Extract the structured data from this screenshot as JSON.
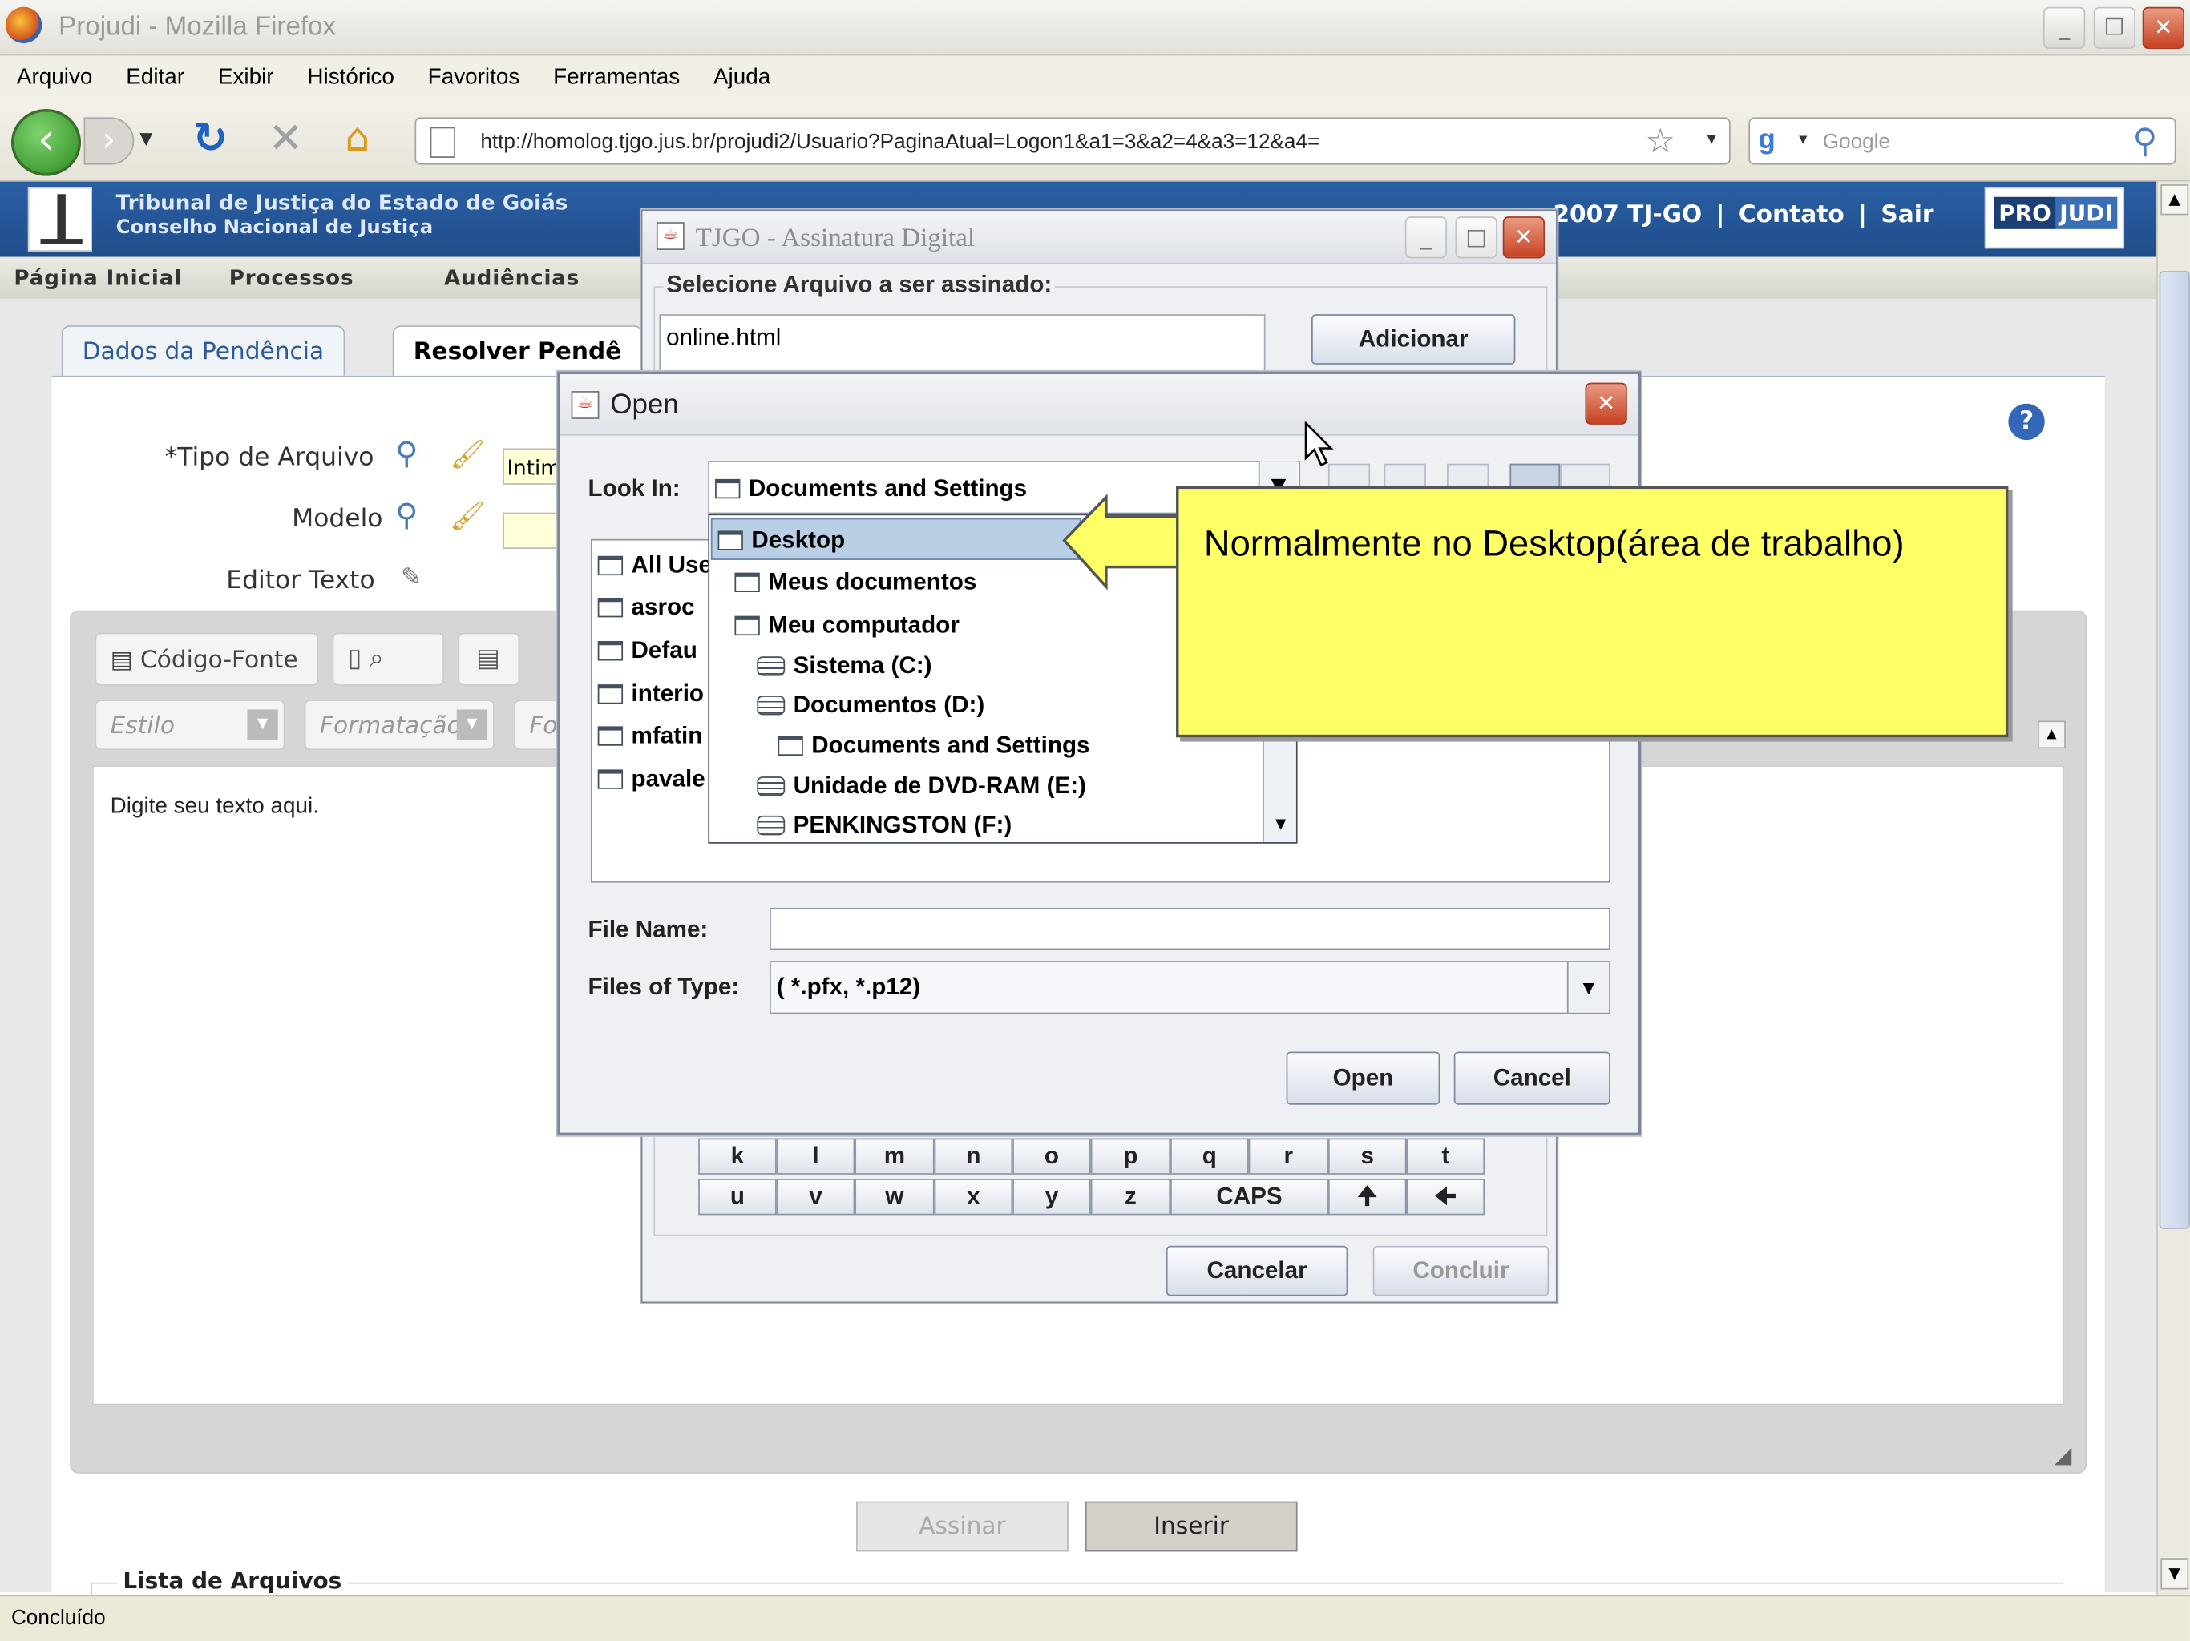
{
  "window": {
    "title": "Projudi - Mozilla Firefox"
  },
  "menu": [
    "Arquivo",
    "Editar",
    "Exibir",
    "Histórico",
    "Favoritos",
    "Ferramentas",
    "Ajuda"
  ],
  "nav": {
    "url": "http://homolog.tjgo.jus.br/projudi2/Usuario?PaginaAtual=Logon1&a1=3&a2=4&a3=12&a4=",
    "search_placeholder": "Google"
  },
  "header": {
    "line1": "Tribunal de Justiça do Estado de Goiás",
    "line2": "Conselho Nacional de Justiça",
    "copyright": "2007 TJ-GO",
    "contato": "Contato",
    "sair": "Sair",
    "logo_pro": "PRO",
    "logo_judi": "JUDI"
  },
  "subnav": [
    "Página Inicial",
    "Processos",
    "Audiências"
  ],
  "tabs": [
    "Dados da Pendência",
    "Resolver Pendê"
  ],
  "form": {
    "tipo_label": "*Tipo de Arquivo",
    "tipo_value": "Intim",
    "modelo_label": "Modelo",
    "editor_label": "Editor Texto"
  },
  "editor": {
    "source_btn": "Código-Fonte",
    "style_ph": "Estilo",
    "format_ph": "Formatação",
    "font_ph": "Fo",
    "body_text": "Digite seu texto aqui."
  },
  "actions": {
    "assinar": "Assinar",
    "inserir": "Inserir",
    "lista": "Lista de Arquivos"
  },
  "status": {
    "text": "Concluído"
  },
  "sign_dialog": {
    "title": "TJGO - Assinatura Digital",
    "legend": "Selecione Arquivo a ser assinado:",
    "file_value": "online.html",
    "add_btn": "Adicionar",
    "cancel_btn": "Cancelar",
    "done_btn": "Concluir",
    "keys_row1": [
      "k",
      "l",
      "m",
      "n",
      "o",
      "p",
      "q",
      "r",
      "s",
      "t"
    ],
    "keys_row2": [
      "u",
      "v",
      "w",
      "x",
      "y",
      "z",
      "CAPS",
      "🠉",
      "🠈"
    ]
  },
  "open_dialog": {
    "title": "Open",
    "look_in_label": "Look In:",
    "look_in_value": "Documents and Settings",
    "files": [
      "All Use",
      "asroc",
      "Defau",
      "interio",
      "mfatin",
      "pavale"
    ],
    "dropdown": [
      {
        "label": "Desktop",
        "kind": "folder",
        "indent": 0,
        "selected": true
      },
      {
        "label": "Meus documentos",
        "kind": "folder",
        "indent": 1
      },
      {
        "label": "Meu computador",
        "kind": "folder",
        "indent": 1
      },
      {
        "label": "Sistema (C:)",
        "kind": "drive",
        "indent": 2
      },
      {
        "label": "Documentos (D:)",
        "kind": "drive",
        "indent": 2
      },
      {
        "label": "Documents and Settings",
        "kind": "folder",
        "indent": 3
      },
      {
        "label": "Unidade de DVD-RAM (E:)",
        "kind": "drive",
        "indent": 2
      },
      {
        "label": "PENKINGSTON (F:)",
        "kind": "drive",
        "indent": 2
      }
    ],
    "file_name_label": "File Name:",
    "file_name_value": "",
    "files_of_type_label": "Files of Type:",
    "files_of_type_value": "( *.pfx, *.p12)",
    "open_btn": "Open",
    "cancel_btn": "Cancel"
  },
  "callout": {
    "text": "Normalmente no Desktop(área de trabalho)"
  },
  "colors": {
    "header_blue": "#1f4e8d",
    "callout_yellow": "#ffff66",
    "close_red": "#c74224"
  }
}
